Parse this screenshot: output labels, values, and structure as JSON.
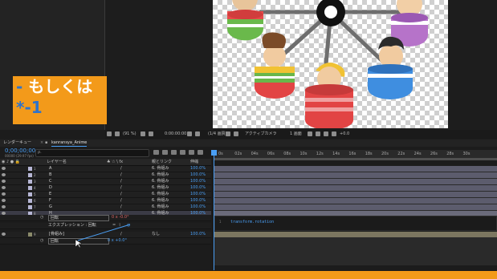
{
  "overlay": {
    "line1_dash": "-",
    "line1_text": "もしくは",
    "line2_star": "*",
    "line2_text": "-1"
  },
  "viewer_bar": {
    "zoom": "(91 %)",
    "timecode": "0:00:00:00",
    "quality": "(1/4 画質)",
    "camera": "アクティブカメラ",
    "view": "1 画面",
    "offset": "+0.0"
  },
  "tabs": {
    "render_queue": "レンダーキュー",
    "comp_tab": "kanransya_Anime"
  },
  "timecode": "0;00;00;00",
  "framecount": "00000 (29.97 fps)",
  "search": {
    "placeholder": "ρ."
  },
  "columns": {
    "layer_name": "レイヤー名",
    "switches": "♣ ☆ \\ fx",
    "parent": "親とリンク",
    "stretch": "伸縮"
  },
  "layers": [
    {
      "num": "1",
      "name": "A",
      "parent": "6. 骨組み",
      "stretch": "100.0%"
    },
    {
      "num": "2",
      "name": "B",
      "parent": "6. 骨組み",
      "stretch": "100.0%"
    },
    {
      "num": "3",
      "name": "C",
      "parent": "6. 骨組み",
      "stretch": "100.0%"
    },
    {
      "num": "4",
      "name": "D",
      "parent": "6. 骨組み",
      "stretch": "100.0%"
    },
    {
      "num": "5",
      "name": "E",
      "parent": "6. 骨組み",
      "stretch": "100.0%"
    },
    {
      "num": "6",
      "name": "F",
      "parent": "6. 骨組み",
      "stretch": "100.0%"
    },
    {
      "num": "7",
      "name": "G",
      "parent": "6. 骨組み",
      "stretch": "100.0%"
    },
    {
      "num": "8",
      "name": "H",
      "parent": "6. 骨組み",
      "stretch": "100.0%"
    }
  ],
  "rotation_row": {
    "label": "回転",
    "value": "0 x -0.0°"
  },
  "expression_row": {
    "label": "エクスプレッション : 回転"
  },
  "frame_layer": {
    "num": "9",
    "name": "[骨組み]",
    "parent": "なし",
    "stretch": "100.0%"
  },
  "frame_rotation": {
    "label": "回転",
    "value": "0 x +0.0°"
  },
  "ruler_ticks": [
    "0s",
    "02s",
    "04s",
    "06s",
    "08s",
    "10s",
    "12s",
    "14s",
    "16s",
    "18s",
    "20s",
    "22s",
    "24s",
    "26s",
    "28s",
    "30s"
  ],
  "expression_text": "transform.rotation",
  "expression_line": "1",
  "colors": {
    "accent": "#f39a1a",
    "blue": "#4a9ff5",
    "overlay_blue": "#2f73c9"
  }
}
